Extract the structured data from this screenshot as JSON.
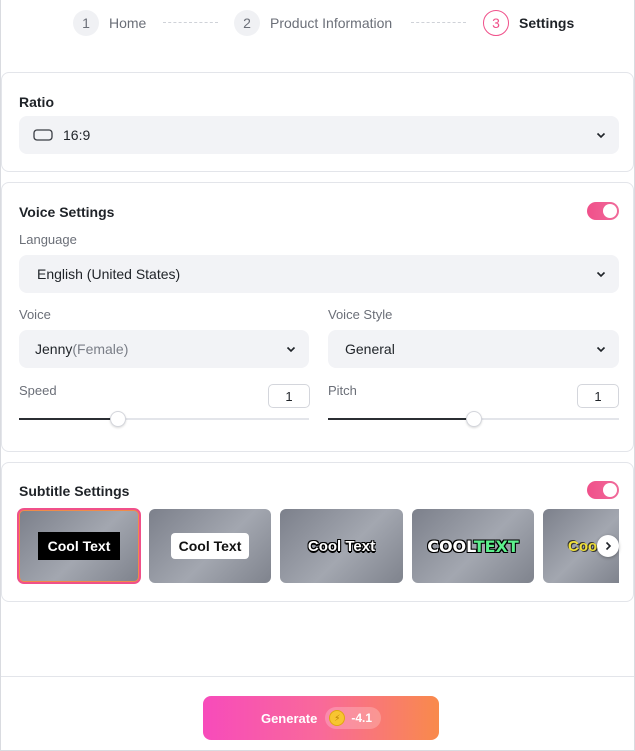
{
  "stepper": {
    "steps": [
      {
        "num": "1",
        "label": "Home"
      },
      {
        "num": "2",
        "label": "Product Information"
      },
      {
        "num": "3",
        "label": "Settings"
      }
    ],
    "active_color": "#f0508a"
  },
  "ratio": {
    "title": "Ratio",
    "value": "16:9",
    "icon": "rectangle-icon"
  },
  "voice": {
    "title": "Voice Settings",
    "enabled": true,
    "language_label": "Language",
    "language_value": "English (United States)",
    "voice_label": "Voice",
    "voice_value": "Jenny",
    "voice_suffix": "(Female)",
    "style_label": "Voice Style",
    "style_value": "General",
    "speed_label": "Speed",
    "speed_value": "1",
    "speed_fill": 0.34,
    "pitch_label": "Pitch",
    "pitch_value": "1",
    "pitch_fill": 0.5
  },
  "subtitle": {
    "title": "Subtitle Settings",
    "enabled": true,
    "styles": [
      {
        "text": "Cool Text",
        "style": "black-box"
      },
      {
        "text": "Cool Text",
        "style": "white-box"
      },
      {
        "text": "Cool Text",
        "style": "outlined"
      },
      {
        "text_a": "COOL",
        "text_b": "TEXT",
        "style": "green-outlined"
      },
      {
        "text": "Coo",
        "style": "yellow"
      }
    ]
  },
  "footer": {
    "generate_label": "Generate",
    "cost": "-4.1",
    "accent_gradient": [
      "#f74bbb",
      "#f98a4b"
    ]
  }
}
